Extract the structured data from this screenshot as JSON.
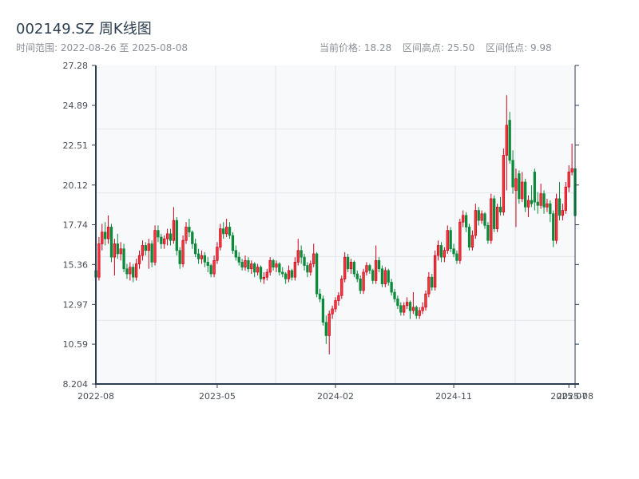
{
  "header": {
    "title": "002149.SZ 周K线图",
    "range_label": "时间范围: 2022-08-26 至 2025-08-08",
    "current_price": "当前价格: 18.28",
    "range_high": "区间高点: 25.50",
    "range_low": "区间低点: 9.98"
  },
  "chart_data": {
    "type": "candlestick",
    "title": "002149.SZ 周K线图",
    "frequency": "weekly",
    "range_start": "2022-08-26",
    "range_end": "2025-08-08",
    "ylim": [
      8.204,
      27.28
    ],
    "y_ticks": [
      "27.28",
      "24.89",
      "22.51",
      "20.12",
      "17.74",
      "15.36",
      "12.97",
      "10.59",
      "8.204"
    ],
    "x_ticks": [
      {
        "label": "2022-08",
        "date": "2022-08-26"
      },
      {
        "label": "2023-05",
        "date": "2023-05-26"
      },
      {
        "label": "2024-02",
        "date": "2024-02-16"
      },
      {
        "label": "2024-11",
        "date": "2024-11-08"
      },
      {
        "label": "2025-07",
        "date": "2025-07-25"
      },
      {
        "label": "2025-08",
        "date": "2025-08-08"
      }
    ],
    "grid": true,
    "colors": {
      "up": "#d0021b",
      "up_fill": "#f03a3a",
      "down": "#0b8a3a",
      "axis": "#2c3e50",
      "grid": "#e3e6ea",
      "plot_bg": "#f7f9fb"
    },
    "ohlc_columns": [
      "open",
      "high",
      "low",
      "close"
    ],
    "candles": [
      [
        15.0,
        15.3,
        13.8,
        14.6
      ],
      [
        14.6,
        17.0,
        14.4,
        16.6
      ],
      [
        16.6,
        17.8,
        16.2,
        17.3
      ],
      [
        17.3,
        17.9,
        16.5,
        16.9
      ],
      [
        16.9,
        18.3,
        16.6,
        17.6
      ],
      [
        17.6,
        17.8,
        15.5,
        15.8
      ],
      [
        15.8,
        16.9,
        14.7,
        16.6
      ],
      [
        16.6,
        17.2,
        15.7,
        16.0
      ],
      [
        16.0,
        16.7,
        15.6,
        16.3
      ],
      [
        16.3,
        16.6,
        14.9,
        15.1
      ],
      [
        15.1,
        15.4,
        14.5,
        14.8
      ],
      [
        14.8,
        15.5,
        14.4,
        15.2
      ],
      [
        15.2,
        15.4,
        14.3,
        14.6
      ],
      [
        14.6,
        15.7,
        14.4,
        15.4
      ],
      [
        15.4,
        16.2,
        15.1,
        15.9
      ],
      [
        15.9,
        16.8,
        15.6,
        16.5
      ],
      [
        16.5,
        16.7,
        15.9,
        16.2
      ],
      [
        16.2,
        16.9,
        15.1,
        16.6
      ],
      [
        16.6,
        16.8,
        15.2,
        15.5
      ],
      [
        15.5,
        17.7,
        15.3,
        17.4
      ],
      [
        17.4,
        17.7,
        16.7,
        17.0
      ],
      [
        17.0,
        17.2,
        16.3,
        16.6
      ],
      [
        16.6,
        17.1,
        16.3,
        16.9
      ],
      [
        16.9,
        17.5,
        16.5,
        17.2
      ],
      [
        17.2,
        17.5,
        16.5,
        16.8
      ],
      [
        16.8,
        18.8,
        16.6,
        18.0
      ],
      [
        18.0,
        18.2,
        15.9,
        16.2
      ],
      [
        16.2,
        16.4,
        15.1,
        15.4
      ],
      [
        15.4,
        17.1,
        15.2,
        16.8
      ],
      [
        16.8,
        17.9,
        16.6,
        17.6
      ],
      [
        17.6,
        18.1,
        17.0,
        17.3
      ],
      [
        17.3,
        17.4,
        16.3,
        16.6
      ],
      [
        16.6,
        16.9,
        15.8,
        16.0
      ],
      [
        16.0,
        16.3,
        15.4,
        15.7
      ],
      [
        15.7,
        16.2,
        15.4,
        15.9
      ],
      [
        15.9,
        16.1,
        15.2,
        15.5
      ],
      [
        15.5,
        15.8,
        14.9,
        15.3
      ],
      [
        15.3,
        15.4,
        14.6,
        14.8
      ],
      [
        14.8,
        15.9,
        14.6,
        15.6
      ],
      [
        15.6,
        16.7,
        15.4,
        16.4
      ],
      [
        16.4,
        17.8,
        16.2,
        17.5
      ],
      [
        17.5,
        17.9,
        16.9,
        17.2
      ],
      [
        17.2,
        18.1,
        17.0,
        17.6
      ],
      [
        17.6,
        17.9,
        16.9,
        17.1
      ],
      [
        17.1,
        17.3,
        16.0,
        16.2
      ],
      [
        16.2,
        16.5,
        15.6,
        15.8
      ],
      [
        15.8,
        16.1,
        15.3,
        15.5
      ],
      [
        15.5,
        15.7,
        15.0,
        15.2
      ],
      [
        15.2,
        15.9,
        15.0,
        15.6
      ],
      [
        15.6,
        15.8,
        14.9,
        15.1
      ],
      [
        15.1,
        15.6,
        14.8,
        15.4
      ],
      [
        15.4,
        15.5,
        14.6,
        14.9
      ],
      [
        14.9,
        15.4,
        14.7,
        15.2
      ],
      [
        15.2,
        15.3,
        14.3,
        14.5
      ],
      [
        14.5,
        14.9,
        14.2,
        14.6
      ],
      [
        14.6,
        15.1,
        14.4,
        14.9
      ],
      [
        14.9,
        15.8,
        14.7,
        15.6
      ],
      [
        15.6,
        15.7,
        15.0,
        15.2
      ],
      [
        15.2,
        15.6,
        14.9,
        15.4
      ],
      [
        15.4,
        15.5,
        14.7,
        14.9
      ],
      [
        14.9,
        15.2,
        14.6,
        14.8
      ],
      [
        14.8,
        14.9,
        14.2,
        14.5
      ],
      [
        14.5,
        15.3,
        14.3,
        15.0
      ],
      [
        15.0,
        15.1,
        14.4,
        14.6
      ],
      [
        14.6,
        15.8,
        14.4,
        15.5
      ],
      [
        15.5,
        16.9,
        15.3,
        16.2
      ],
      [
        16.2,
        16.5,
        15.4,
        15.8
      ],
      [
        15.8,
        16.0,
        15.0,
        15.3
      ],
      [
        15.3,
        15.5,
        14.6,
        14.9
      ],
      [
        14.9,
        15.6,
        14.7,
        15.4
      ],
      [
        15.4,
        16.6,
        15.2,
        16.0
      ],
      [
        16.0,
        16.1,
        13.4,
        13.6
      ],
      [
        13.6,
        13.9,
        13.1,
        13.3
      ],
      [
        13.3,
        13.5,
        11.7,
        11.9
      ],
      [
        11.9,
        12.3,
        10.6,
        11.1
      ],
      [
        11.1,
        12.6,
        9.98,
        12.4
      ],
      [
        12.4,
        12.9,
        12.1,
        12.7
      ],
      [
        12.7,
        13.4,
        12.5,
        13.2
      ],
      [
        13.2,
        13.7,
        12.9,
        13.5
      ],
      [
        13.5,
        14.7,
        13.3,
        14.5
      ],
      [
        14.5,
        16.1,
        14.3,
        15.8
      ],
      [
        15.8,
        16.0,
        14.9,
        15.1
      ],
      [
        15.1,
        15.7,
        14.8,
        15.5
      ],
      [
        15.5,
        15.6,
        14.6,
        14.8
      ],
      [
        14.8,
        15.0,
        14.3,
        14.5
      ],
      [
        14.5,
        14.7,
        13.6,
        13.8
      ],
      [
        13.8,
        15.1,
        13.6,
        14.9
      ],
      [
        14.9,
        15.5,
        14.7,
        15.3
      ],
      [
        15.3,
        15.4,
        14.8,
        15.0
      ],
      [
        15.0,
        15.1,
        14.2,
        14.4
      ],
      [
        14.4,
        16.5,
        14.2,
        15.6
      ],
      [
        15.6,
        15.8,
        14.9,
        15.1
      ],
      [
        15.1,
        15.3,
        14.0,
        14.2
      ],
      [
        14.2,
        15.2,
        14.0,
        15.0
      ],
      [
        15.0,
        15.1,
        14.1,
        14.3
      ],
      [
        14.3,
        14.5,
        13.5,
        13.7
      ],
      [
        13.7,
        13.9,
        13.1,
        13.3
      ],
      [
        13.3,
        13.5,
        12.7,
        12.9
      ],
      [
        12.9,
        13.1,
        12.3,
        12.5
      ],
      [
        12.5,
        13.1,
        12.3,
        12.9
      ],
      [
        12.9,
        13.4,
        12.7,
        13.1
      ],
      [
        13.1,
        13.2,
        12.1,
        12.6
      ],
      [
        12.6,
        13.7,
        12.4,
        12.8
      ],
      [
        12.8,
        12.9,
        12.1,
        12.3
      ],
      [
        12.3,
        12.8,
        12.1,
        12.6
      ],
      [
        12.6,
        13.1,
        12.4,
        12.8
      ],
      [
        12.8,
        13.8,
        12.6,
        13.6
      ],
      [
        13.6,
        14.9,
        13.4,
        14.6
      ],
      [
        14.6,
        14.8,
        13.8,
        14.0
      ],
      [
        14.0,
        16.2,
        13.8,
        15.9
      ],
      [
        15.9,
        16.8,
        15.6,
        16.5
      ],
      [
        16.5,
        16.7,
        15.5,
        15.8
      ],
      [
        15.8,
        16.4,
        15.5,
        16.2
      ],
      [
        16.2,
        17.7,
        16.0,
        17.4
      ],
      [
        17.4,
        17.6,
        16.1,
        16.3
      ],
      [
        16.3,
        16.6,
        15.8,
        16.0
      ],
      [
        16.0,
        16.2,
        15.4,
        15.6
      ],
      [
        15.6,
        18.1,
        15.4,
        17.9
      ],
      [
        17.9,
        18.6,
        17.6,
        18.3
      ],
      [
        18.3,
        18.5,
        17.3,
        17.6
      ],
      [
        17.6,
        17.8,
        16.2,
        16.4
      ],
      [
        16.4,
        17.4,
        16.2,
        17.1
      ],
      [
        17.1,
        19.0,
        16.9,
        18.6
      ],
      [
        18.6,
        18.8,
        17.7,
        18.0
      ],
      [
        18.0,
        18.6,
        17.8,
        18.4
      ],
      [
        18.4,
        18.5,
        17.5,
        17.7
      ],
      [
        17.7,
        17.9,
        16.6,
        16.8
      ],
      [
        16.8,
        19.6,
        16.6,
        19.3
      ],
      [
        19.3,
        19.5,
        17.3,
        17.5
      ],
      [
        17.5,
        19.0,
        17.3,
        18.8
      ],
      [
        18.8,
        19.4,
        18.3,
        18.5
      ],
      [
        18.5,
        22.3,
        18.3,
        21.9
      ],
      [
        21.9,
        25.5,
        19.8,
        23.7
      ],
      [
        24.0,
        24.5,
        21.4,
        21.6
      ],
      [
        21.6,
        22.2,
        19.6,
        20.0
      ],
      [
        19.8,
        21.1,
        17.6,
        20.5
      ],
      [
        20.8,
        21.0,
        19.0,
        19.3
      ],
      [
        19.3,
        20.9,
        19.1,
        20.3
      ],
      [
        20.3,
        20.5,
        18.5,
        18.8
      ],
      [
        18.8,
        19.5,
        18.2,
        19.2
      ],
      [
        19.2,
        20.1,
        18.8,
        19.0
      ],
      [
        20.9,
        21.1,
        18.6,
        19.1
      ],
      [
        19.1,
        19.7,
        18.4,
        18.9
      ],
      [
        18.9,
        20.2,
        18.7,
        19.6
      ],
      [
        19.6,
        19.8,
        18.4,
        18.8
      ],
      [
        18.8,
        19.3,
        18.5,
        19.0
      ],
      [
        19.0,
        19.2,
        17.9,
        18.4
      ],
      [
        18.4,
        18.6,
        16.4,
        16.8
      ],
      [
        16.8,
        19.6,
        16.6,
        19.3
      ],
      [
        19.3,
        20.3,
        18.0,
        18.3
      ],
      [
        18.3,
        19.0,
        18.0,
        18.6
      ],
      [
        18.6,
        20.3,
        18.4,
        20.0
      ],
      [
        20.0,
        21.3,
        19.7,
        20.9
      ],
      [
        20.9,
        22.6,
        20.7,
        21.1
      ],
      [
        21.1,
        22.8,
        17.8,
        18.28
      ]
    ]
  }
}
